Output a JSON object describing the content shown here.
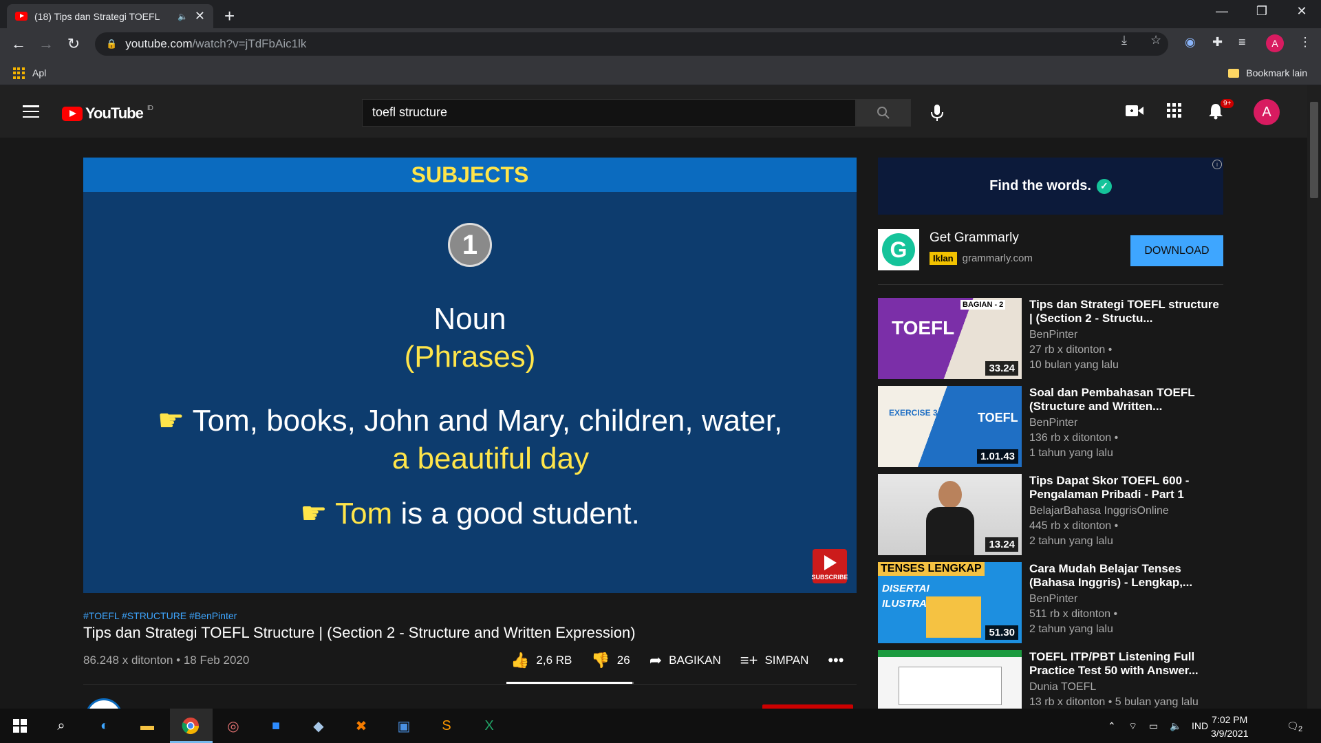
{
  "browser": {
    "tab_title": "(18) Tips dan Strategi TOEFL",
    "url_domain": "youtube.com",
    "url_path": "/watch?v=jTdFbAic1lk",
    "bookmarks_apps_label": "Apl",
    "bookmarks_other_label": "Bookmark lain",
    "profile_initial": "A"
  },
  "header": {
    "logo_text": "YouTube",
    "region": "ID",
    "search_value": "toefl structure",
    "notification_count": "9+",
    "avatar_initial": "A"
  },
  "player": {
    "slide_title": "SUBJECTS",
    "slide_number": "1",
    "slide_heading": "Noun",
    "slide_subheading": "(Phrases)",
    "example1_white": "Tom, books, John and Mary, children, water,",
    "example1_yellow": "a beautiful day",
    "example2_yellow": "Tom",
    "example2_white": "is a good student.",
    "subscribe_label": "SUBSCRIBE"
  },
  "video": {
    "hashtags": "#TOEFL #STRUCTURE #BenPinter",
    "title": "Tips dan Strategi TOEFL Structure | (Section 2 - Structure and Written Expression)",
    "meta": "86.248 x ditonton • 18 Feb 2020",
    "likes": "2,6 RB",
    "dislikes": "26",
    "share_label": "BAGIKAN",
    "save_label": "SIMPAN",
    "like_ratio": 0.99
  },
  "ad": {
    "banner_text": "Find the words.",
    "name": "Get Grammarly",
    "badge": "Iklan",
    "domain": "grammarly.com",
    "cta": "DOWNLOAD"
  },
  "recommendations": [
    {
      "title": "Tips dan Strategi TOEFL structure | (Section 2 - Structu...",
      "channel": "BenPinter",
      "views": "27 rb x ditonton •",
      "age": "10 bulan yang lalu",
      "duration": "33.24",
      "thumb_text": "TOEFL",
      "thumb_tag": "BAGIAN - 2"
    },
    {
      "title": "Soal dan Pembahasan TOEFL (Structure and Written...",
      "channel": "BenPinter",
      "views": "136 rb x ditonton •",
      "age": "1 tahun yang lalu",
      "duration": "1.01.43",
      "thumb_text": "TOEFL",
      "thumb_tag": "EXERCISE 3"
    },
    {
      "title": "Tips Dapat Skor TOEFL 600 - Pengalaman Pribadi - Part 1",
      "channel": "BelajarBahasa InggrisOnline",
      "views": "445 rb x ditonton •",
      "age": "2 tahun yang lalu",
      "duration": "13.24"
    },
    {
      "title": "Cara Mudah Belajar Tenses (Bahasa Inggris) - Lengkap,...",
      "channel": "BenPinter",
      "views": "511 rb x ditonton •",
      "age": "2 tahun yang lalu",
      "duration": "51.30",
      "thumb_text": "TENSES LENGKAP",
      "thumb_tag": "DISERTAI ILUSTRASI"
    },
    {
      "title": "TOEFL ITP/PBT Listening Full Practice Test 50 with Answer...",
      "channel": "Dunia TOEFL",
      "views": "13 rb x ditonton • 5 bulan yang lalu",
      "age": "",
      "duration": ""
    }
  ],
  "taskbar": {
    "language": "IND",
    "time": "7:02 PM",
    "date": "3/9/2021",
    "notification_count": "2"
  }
}
